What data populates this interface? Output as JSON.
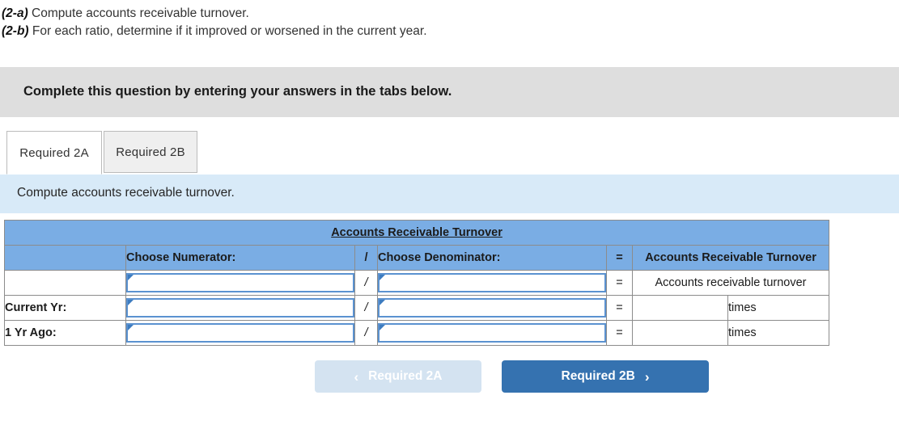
{
  "prompt": {
    "lines": [
      {
        "tag": "(2-a)",
        "text": "Compute accounts receivable turnover."
      },
      {
        "tag": "(2-b)",
        "text": "For each ratio, determine if it improved or worsened in the current year."
      }
    ]
  },
  "banner": {
    "text": "Complete this question by entering your answers in the tabs below."
  },
  "tabs": [
    {
      "label": "Required 2A",
      "active": true
    },
    {
      "label": "Required 2B",
      "active": false
    }
  ],
  "subbar": {
    "text": "Compute accounts receivable turnover."
  },
  "table": {
    "title": "Accounts Receivable Turnover",
    "headers": {
      "row_label": "",
      "numerator": "Choose Numerator:",
      "slash": "/",
      "denominator": "Choose Denominator:",
      "equals": "=",
      "result": "Accounts Receivable Turnover"
    },
    "rows": [
      {
        "label": "",
        "numerator_value": "",
        "slash": "/",
        "denominator_value": "",
        "equals": "=",
        "result_text": "Accounts receivable turnover",
        "units": ""
      },
      {
        "label": "Current Yr:",
        "numerator_value": "",
        "slash": "/",
        "denominator_value": "",
        "equals": "=",
        "result_text": "",
        "units": "times"
      },
      {
        "label": "1 Yr Ago:",
        "numerator_value": "",
        "slash": "/",
        "denominator_value": "",
        "equals": "=",
        "result_text": "",
        "units": "times"
      }
    ]
  },
  "nav": {
    "prev_label": "Required 2A",
    "prev_icon": "chevron-left-icon",
    "prev_glyph": "‹",
    "next_label": "Required 2B",
    "next_icon": "chevron-right-icon",
    "next_glyph": "›"
  },
  "colors": {
    "banner_grey": "#dedede",
    "subbar_blue": "#d8eaf8",
    "table_header_blue": "#7aade4",
    "primary_button": "#3572b0",
    "disabled_button": "#d4e3f1",
    "field_border": "#5b92d0"
  }
}
